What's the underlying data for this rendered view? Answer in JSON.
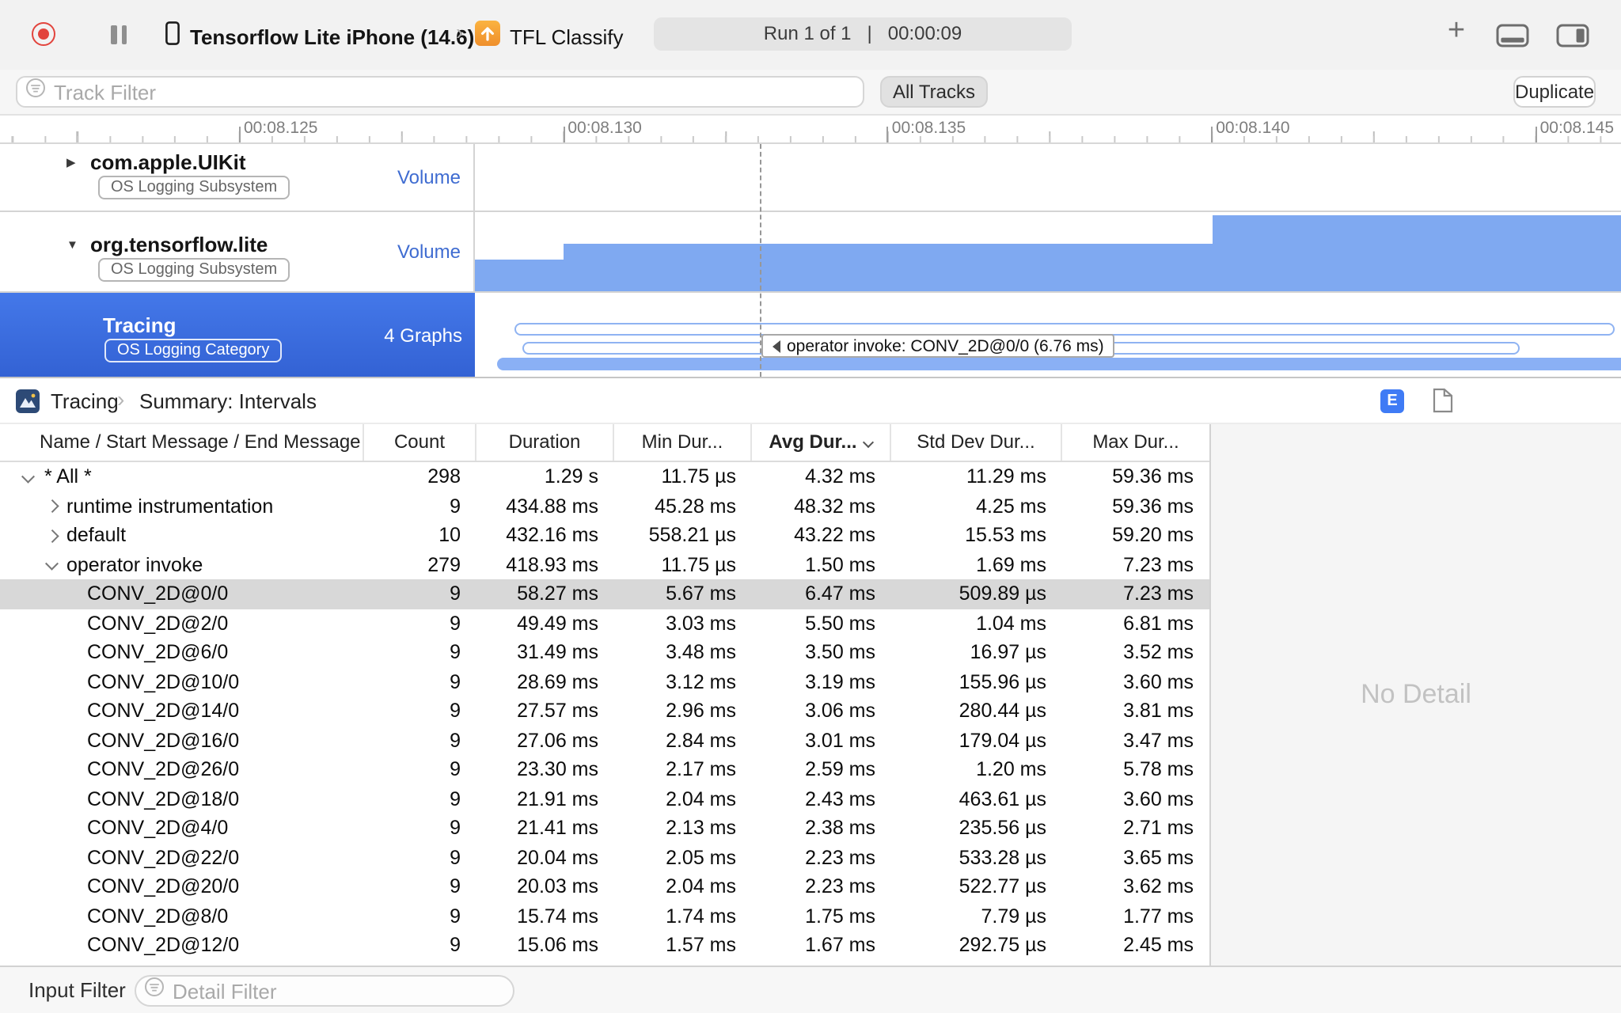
{
  "toolbar": {
    "device_name": "Tensorflow Lite iPhone (14.6)",
    "app_name": "TFL Classify",
    "run_status": "Run 1 of 1   |   00:00:09"
  },
  "filter_bar": {
    "track_filter_placeholder": "Track Filter",
    "all_tracks": "All Tracks",
    "duplicate": "Duplicate"
  },
  "ruler": {
    "labels": [
      "00:08.125",
      "00:08.130",
      "00:08.135",
      "00:08.140",
      "00:08.145"
    ]
  },
  "tracks": [
    {
      "name": "com.apple.UIKit",
      "badge": "OS Logging Subsystem",
      "meta": "Volume",
      "selected": false
    },
    {
      "name": "org.tensorflow.lite",
      "badge": "OS Logging Subsystem",
      "meta": "Volume",
      "selected": false
    },
    {
      "name": "Tracing",
      "badge": "OS Logging Category",
      "meta": "4 Graphs",
      "selected": true
    }
  ],
  "timeline": {
    "tooltip": "operator invoke: CONV_2D@0/0 (6.76 ms)"
  },
  "detail_pane": {
    "breadcrumb": {
      "root": "Tracing",
      "page": "Summary: Intervals"
    },
    "e_icon_label": "E",
    "no_detail": "No Detail",
    "table": {
      "columns": [
        "Name / Start Message / End Message",
        "Count",
        "Duration",
        "Min Dur...",
        "Avg Dur...",
        "Std Dev Dur...",
        "Max Dur..."
      ],
      "sorted_column": "Avg Dur...",
      "rows": [
        {
          "name": "* All *",
          "count": "298",
          "duration": "1.29 s",
          "min": "11.75 µs",
          "avg": "4.32 ms",
          "std": "11.29 ms",
          "max": "59.36 ms",
          "level": 0,
          "disclosure": "open",
          "selected": false
        },
        {
          "name": "runtime instrumentation",
          "count": "9",
          "duration": "434.88 ms",
          "min": "45.28 ms",
          "avg": "48.32 ms",
          "std": "4.25 ms",
          "max": "59.36 ms",
          "level": 1,
          "disclosure": "closed",
          "selected": false
        },
        {
          "name": "default",
          "count": "10",
          "duration": "432.16 ms",
          "min": "558.21 µs",
          "avg": "43.22 ms",
          "std": "15.53 ms",
          "max": "59.20 ms",
          "level": 1,
          "disclosure": "closed",
          "selected": false
        },
        {
          "name": "operator invoke",
          "count": "279",
          "duration": "418.93 ms",
          "min": "11.75 µs",
          "avg": "1.50 ms",
          "std": "1.69 ms",
          "max": "7.23 ms",
          "level": 1,
          "disclosure": "open",
          "selected": false
        },
        {
          "name": "CONV_2D@0/0",
          "count": "9",
          "duration": "58.27 ms",
          "min": "5.67 ms",
          "avg": "6.47 ms",
          "std": "509.89 µs",
          "max": "7.23 ms",
          "level": 2,
          "disclosure": null,
          "selected": true
        },
        {
          "name": "CONV_2D@2/0",
          "count": "9",
          "duration": "49.49 ms",
          "min": "3.03 ms",
          "avg": "5.50 ms",
          "std": "1.04 ms",
          "max": "6.81 ms",
          "level": 2,
          "disclosure": null,
          "selected": false
        },
        {
          "name": "CONV_2D@6/0",
          "count": "9",
          "duration": "31.49 ms",
          "min": "3.48 ms",
          "avg": "3.50 ms",
          "std": "16.97 µs",
          "max": "3.52 ms",
          "level": 2,
          "disclosure": null,
          "selected": false
        },
        {
          "name": "CONV_2D@10/0",
          "count": "9",
          "duration": "28.69 ms",
          "min": "3.12 ms",
          "avg": "3.19 ms",
          "std": "155.96 µs",
          "max": "3.60 ms",
          "level": 2,
          "disclosure": null,
          "selected": false
        },
        {
          "name": "CONV_2D@14/0",
          "count": "9",
          "duration": "27.57 ms",
          "min": "2.96 ms",
          "avg": "3.06 ms",
          "std": "280.44 µs",
          "max": "3.81 ms",
          "level": 2,
          "disclosure": null,
          "selected": false
        },
        {
          "name": "CONV_2D@16/0",
          "count": "9",
          "duration": "27.06 ms",
          "min": "2.84 ms",
          "avg": "3.01 ms",
          "std": "179.04 µs",
          "max": "3.47 ms",
          "level": 2,
          "disclosure": null,
          "selected": false
        },
        {
          "name": "CONV_2D@26/0",
          "count": "9",
          "duration": "23.30 ms",
          "min": "2.17 ms",
          "avg": "2.59 ms",
          "std": "1.20 ms",
          "max": "5.78 ms",
          "level": 2,
          "disclosure": null,
          "selected": false
        },
        {
          "name": "CONV_2D@18/0",
          "count": "9",
          "duration": "21.91 ms",
          "min": "2.04 ms",
          "avg": "2.43 ms",
          "std": "463.61 µs",
          "max": "3.60 ms",
          "level": 2,
          "disclosure": null,
          "selected": false
        },
        {
          "name": "CONV_2D@4/0",
          "count": "9",
          "duration": "21.41 ms",
          "min": "2.13 ms",
          "avg": "2.38 ms",
          "std": "235.56 µs",
          "max": "2.71 ms",
          "level": 2,
          "disclosure": null,
          "selected": false
        },
        {
          "name": "CONV_2D@22/0",
          "count": "9",
          "duration": "20.04 ms",
          "min": "2.05 ms",
          "avg": "2.23 ms",
          "std": "533.28 µs",
          "max": "3.65 ms",
          "level": 2,
          "disclosure": null,
          "selected": false
        },
        {
          "name": "CONV_2D@20/0",
          "count": "9",
          "duration": "20.03 ms",
          "min": "2.04 ms",
          "avg": "2.23 ms",
          "std": "522.77 µs",
          "max": "3.62 ms",
          "level": 2,
          "disclosure": null,
          "selected": false
        },
        {
          "name": "CONV_2D@8/0",
          "count": "9",
          "duration": "15.74 ms",
          "min": "1.74 ms",
          "avg": "1.75 ms",
          "std": "7.79 µs",
          "max": "1.77 ms",
          "level": 2,
          "disclosure": null,
          "selected": false
        },
        {
          "name": "CONV_2D@12/0",
          "count": "9",
          "duration": "15.06 ms",
          "min": "1.57 ms",
          "avg": "1.67 ms",
          "std": "292.75 µs",
          "max": "2.45 ms",
          "level": 2,
          "disclosure": null,
          "selected": false
        }
      ]
    }
  },
  "bottom_bar": {
    "input_filter": "Input Filter",
    "detail_filter_placeholder": "Detail Filter"
  },
  "colors": {
    "selection_blue": "#3d6fe3",
    "graph_blue": "#7fa9f1",
    "record_red": "#e2443d",
    "e_badge_blue": "#3f7bf5",
    "selected_row_gray": "#d8d8d8"
  }
}
